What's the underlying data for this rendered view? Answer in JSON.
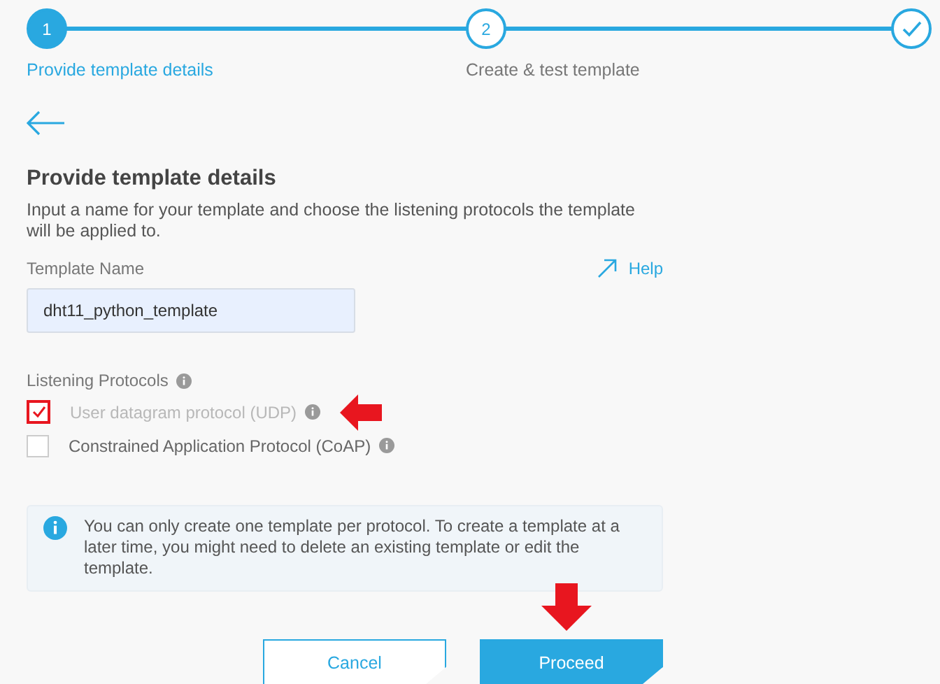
{
  "stepper": {
    "steps": [
      {
        "kind": "number",
        "number": "1",
        "label": "Provide template details",
        "selected": true
      },
      {
        "kind": "number",
        "number": "2",
        "label": "Create & test template",
        "selected": false
      },
      {
        "kind": "finish"
      }
    ]
  },
  "back_button": {
    "kind": "arrow"
  },
  "form": {
    "title": "Provide template details",
    "description": "Input a name for your template and choose the listening protocols the template will be applied to.",
    "help_link": "Help",
    "template_name": {
      "label": "Template Name",
      "value": "dht11_python_template"
    },
    "protocols": {
      "label": "Listening Protocols",
      "items": [
        {
          "label": "User datagram protocol (UDP)",
          "checked": true,
          "disabled": true,
          "annotated": true
        },
        {
          "label": "Constrained Application Protocol (CoAP)",
          "checked": false,
          "disabled": false,
          "annotated": false
        }
      ]
    },
    "info": "You can only create one template per protocol. To create a template at a later time, you might need to delete an existing template or edit the template."
  },
  "buttons": [
    {
      "kind": "secondary",
      "label": "Cancel",
      "annotated": false
    },
    {
      "kind": "primary",
      "label": "Proceed",
      "annotated": true
    }
  ]
}
